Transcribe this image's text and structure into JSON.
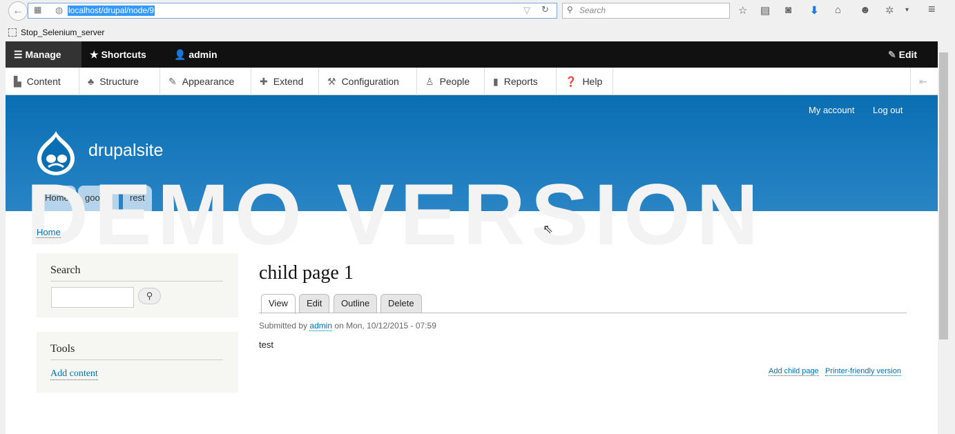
{
  "browser": {
    "url": "localhost/drupal/node/9",
    "search_placeholder": "Search",
    "bookmark": "Stop_Selenium_server"
  },
  "toolbar": {
    "manage": "Manage",
    "shortcuts": "Shortcuts",
    "user": "admin",
    "edit": "Edit"
  },
  "tray": [
    {
      "label": "Content",
      "icon": "file-icon",
      "glyph": "▙"
    },
    {
      "label": "Structure",
      "icon": "sitemap-icon",
      "glyph": "♣"
    },
    {
      "label": "Appearance",
      "icon": "paintbrush-icon",
      "glyph": "✎"
    },
    {
      "label": "Extend",
      "icon": "puzzle-icon",
      "glyph": "✚"
    },
    {
      "label": "Configuration",
      "icon": "wrench-icon",
      "glyph": "🔧"
    },
    {
      "label": "People",
      "icon": "people-icon",
      "glyph": "👤"
    },
    {
      "label": "Reports",
      "icon": "chart-icon",
      "glyph": "▮"
    },
    {
      "label": "Help",
      "icon": "help-icon",
      "glyph": "?"
    }
  ],
  "header": {
    "site_name": "drupalsite",
    "my_account": "My account",
    "log_out": "Log out",
    "nav": [
      "Home",
      "google",
      "rest"
    ]
  },
  "watermark": "DEMO VERSION",
  "breadcrumb": "Home",
  "sidebar": {
    "search_title": "Search",
    "tools_title": "Tools",
    "add_content": "Add content"
  },
  "node": {
    "title": "child page 1",
    "tabs": [
      "View",
      "Edit",
      "Outline",
      "Delete"
    ],
    "submitted_by": "Submitted by",
    "author": "admin",
    "date": "on Mon, 10/12/2015 - 07:59",
    "body": "test",
    "links": [
      "Add child page",
      "Printer-friendly version"
    ]
  }
}
